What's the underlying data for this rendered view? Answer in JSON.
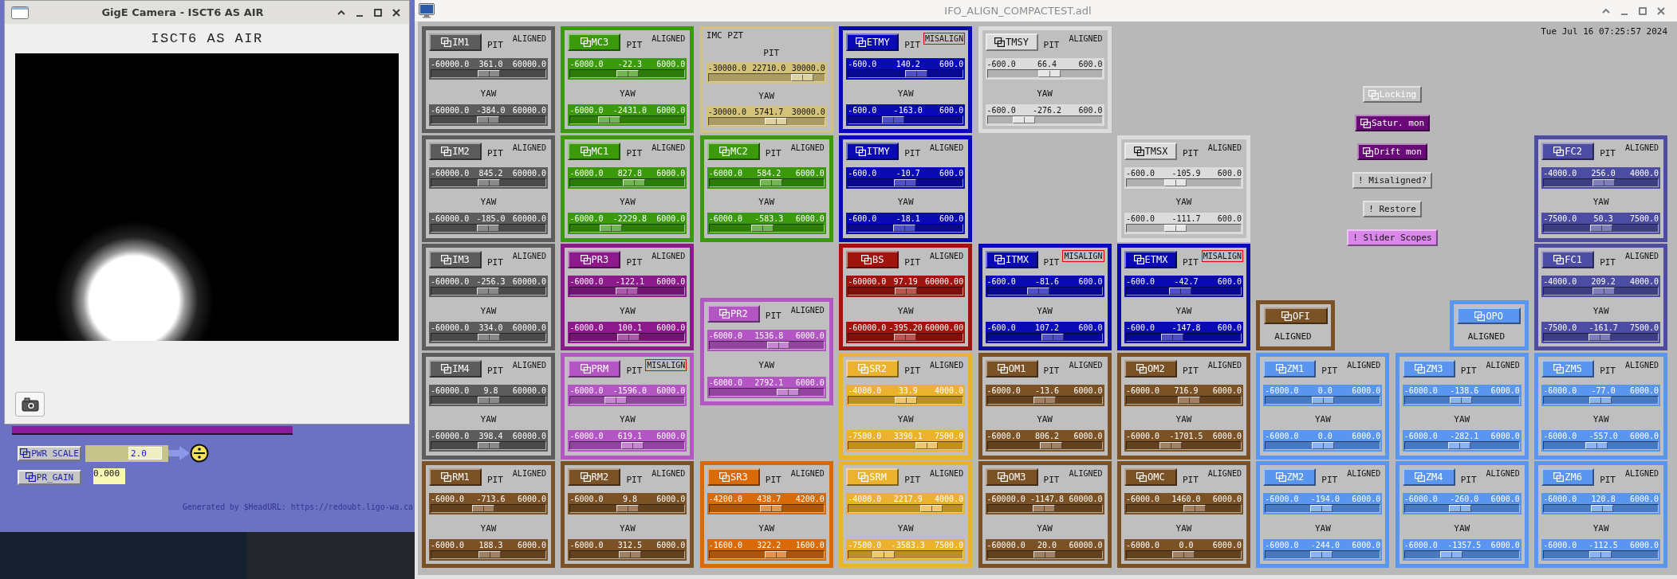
{
  "camera_window": {
    "title": "GigE Camera - ISCT6 AS AIR",
    "heading": "ISCT6 AS AIR"
  },
  "control_panel": {
    "controls": [
      {
        "kind": "entry",
        "label": "PWR SCALE",
        "value": "2.0"
      },
      {
        "kind": "readback",
        "label": "PR_GAIN",
        "value": "0.000"
      }
    ],
    "footer": "Generated by $HeadURL: https://redoubt.ligo-wa.ca"
  },
  "main_window": {
    "title": "IFO_ALIGN_COMPACTEST.adl",
    "timestamp": "Tue Jul 16 07:25:57 2024",
    "buttons": [
      {
        "kind": "related",
        "label": "Locking",
        "color": "#c4c4c4"
      },
      {
        "kind": "related",
        "label": "Satur. mon",
        "color": "#6a0a78"
      },
      {
        "kind": "related",
        "label": "Drift mon",
        "color": "#6a0a78"
      },
      {
        "kind": "shell",
        "label": "! Misaligned?",
        "color": "#c8c8c8"
      },
      {
        "kind": "shell",
        "label": "! Restore",
        "color": "#c8c8c8"
      },
      {
        "kind": "shell",
        "label": "! Slider Scopes",
        "color": "#d987e8"
      }
    ],
    "cards": [
      {
        "name": "IM1",
        "kind": "mirror",
        "color": "#5c5c5c",
        "status": "ALIGNED",
        "alarm": false,
        "sliders": [
          {
            "label": "PIT",
            "low": "-60000.0",
            "value": "361.0",
            "high": "60000.0",
            "level": 0.503
          },
          {
            "label": "YAW",
            "low": "-60000.0",
            "value": "-384.0",
            "high": "60000.0",
            "level": 0.497
          }
        ]
      },
      {
        "name": "MC3",
        "kind": "mirror",
        "color": "#3a9a0c",
        "status": "ALIGNED",
        "alarm": false,
        "sliders": [
          {
            "label": "PIT",
            "low": "-6000.0",
            "value": "-22.3",
            "high": "6000.0",
            "level": 0.498
          },
          {
            "label": "YAW",
            "low": "-6000.0",
            "value": "-2431.0",
            "high": "6000.0",
            "level": 0.297
          }
        ]
      },
      {
        "name": "IMC PZT",
        "kind": "pzt",
        "color": "#d3c27a",
        "sliders": [
          {
            "label": "PIT",
            "low": "-30000.0",
            "value": "22710.0",
            "high": "30000.0",
            "level": 0.879
          },
          {
            "label": "YAW",
            "low": "-30000.0",
            "value": "5741.7",
            "high": "30000.0",
            "level": 0.596
          }
        ]
      },
      {
        "name": "ETMY",
        "kind": "mirror",
        "color": "#0a0ab4",
        "status": "MISALIGN",
        "alarm": true,
        "sliders": [
          {
            "label": "PIT",
            "low": "-600.0",
            "value": "140.2",
            "high": "600.0",
            "level": 0.617
          },
          {
            "label": "YAW",
            "low": "-600.0",
            "value": "-163.0",
            "high": "600.0",
            "level": 0.364
          }
        ]
      },
      {
        "name": "TMSY",
        "kind": "mirror",
        "color": "#dcdcdc",
        "status": "ALIGNED",
        "alarm": false,
        "sliders": [
          {
            "label": "PIT",
            "low": "-600.0",
            "value": "66.4",
            "high": "600.0",
            "level": 0.555
          },
          {
            "label": "YAW",
            "low": "-600.0",
            "value": "-276.2",
            "high": "600.0",
            "level": 0.27
          }
        ]
      },
      {
        "name": "IM2",
        "kind": "mirror",
        "color": "#5c5c5c",
        "status": "ALIGNED",
        "alarm": false,
        "sliders": [
          {
            "label": "PIT",
            "low": "-60000.0",
            "value": "845.2",
            "high": "60000.0",
            "level": 0.507
          },
          {
            "label": "YAW",
            "low": "-60000.0",
            "value": "-185.0",
            "high": "60000.0",
            "level": 0.498
          }
        ]
      },
      {
        "name": "MC1",
        "kind": "mirror",
        "color": "#3a9a0c",
        "status": "ALIGNED",
        "alarm": false,
        "sliders": [
          {
            "label": "PIT",
            "low": "-6000.0",
            "value": "827.8",
            "high": "6000.0",
            "level": 0.569
          },
          {
            "label": "YAW",
            "low": "-6000.0",
            "value": "-2229.8",
            "high": "6000.0",
            "level": 0.314
          }
        ]
      },
      {
        "name": "MC2",
        "kind": "mirror",
        "color": "#3a9a0c",
        "status": "ALIGNED",
        "alarm": false,
        "sliders": [
          {
            "label": "PIT",
            "low": "-6000.0",
            "value": "584.2",
            "high": "6000.0",
            "level": 0.549
          },
          {
            "label": "YAW",
            "low": "-6000.0",
            "value": "-583.3",
            "high": "6000.0",
            "level": 0.451
          }
        ]
      },
      {
        "name": "ITMY",
        "kind": "mirror",
        "color": "#0a0ab4",
        "status": "ALIGNED",
        "alarm": false,
        "sliders": [
          {
            "label": "PIT",
            "low": "-600.0",
            "value": "-10.7",
            "high": "600.0",
            "level": 0.491
          },
          {
            "label": "YAW",
            "low": "-600.0",
            "value": "-18.1",
            "high": "600.0",
            "level": 0.485
          }
        ]
      },
      {
        "name": "TMSX",
        "kind": "mirror",
        "color": "#dcdcdc",
        "status": "ALIGNED",
        "alarm": false,
        "sliders": [
          {
            "label": "PIT",
            "low": "-600.0",
            "value": "-105.9",
            "high": "600.0",
            "level": 0.412
          },
          {
            "label": "YAW",
            "low": "-600.0",
            "value": "-111.7",
            "high": "600.0",
            "level": 0.407
          }
        ]
      },
      {
        "name": "FC2",
        "kind": "mirror",
        "color": "#4c4ca2",
        "status": "ALIGNED",
        "alarm": false,
        "sliders": [
          {
            "label": "PIT",
            "low": "-4000.0",
            "value": "256.0",
            "high": "4000.0",
            "level": 0.532
          },
          {
            "label": "YAW",
            "low": "-7500.0",
            "value": "50.3",
            "high": "7500.0",
            "level": 0.503
          }
        ]
      },
      {
        "name": "IM3",
        "kind": "mirror",
        "color": "#5c5c5c",
        "status": "ALIGNED",
        "alarm": false,
        "sliders": [
          {
            "label": "PIT",
            "low": "-60000.0",
            "value": "-256.3",
            "high": "60000.0",
            "level": 0.498
          },
          {
            "label": "YAW",
            "low": "-60000.0",
            "value": "334.0",
            "high": "60000.0",
            "level": 0.503
          }
        ]
      },
      {
        "name": "PR3",
        "kind": "mirror",
        "color": "#8c1a8c",
        "status": "ALIGNED",
        "alarm": false,
        "sliders": [
          {
            "label": "PIT",
            "low": "-6000.0",
            "value": "-122.1",
            "high": "6000.0",
            "level": 0.49
          },
          {
            "label": "YAW",
            "low": "-6000.0",
            "value": "100.1",
            "high": "6000.0",
            "level": 0.508
          }
        ]
      },
      {
        "name": "BS",
        "kind": "mirror",
        "color": "#a0140e",
        "status": "ALIGNED",
        "alarm": false,
        "sliders": [
          {
            "label": "PIT",
            "low": "-60000.0",
            "value": "97.19",
            "high": "60000.00",
            "level": 0.501
          },
          {
            "label": "YAW",
            "low": "-60000.0",
            "value": "-395.20",
            "high": "60000.00",
            "level": 0.497
          }
        ]
      },
      {
        "name": "ITMX",
        "kind": "mirror",
        "color": "#0a0ab4",
        "status": "MISALIGN",
        "alarm": true,
        "sliders": [
          {
            "label": "PIT",
            "low": "-600.0",
            "value": "-81.6",
            "high": "600.0",
            "level": 0.432
          },
          {
            "label": "YAW",
            "low": "-600.0",
            "value": "107.2",
            "high": "600.0",
            "level": 0.589
          }
        ]
      },
      {
        "name": "ETMX",
        "kind": "mirror",
        "color": "#0a0ab4",
        "status": "MISALIGN",
        "alarm": true,
        "sliders": [
          {
            "label": "PIT",
            "low": "-600.0",
            "value": "-42.7",
            "high": "600.0",
            "level": 0.464
          },
          {
            "label": "YAW",
            "low": "-600.0",
            "value": "-147.8",
            "high": "600.0",
            "level": 0.377
          }
        ]
      },
      {
        "name": "OFI",
        "kind": "compact",
        "color": "#7b5226",
        "status": "ALIGNED",
        "alarm": false
      },
      {
        "name": "OPO",
        "kind": "compact",
        "color": "#5a96f0",
        "status": "ALIGNED",
        "alarm": false
      },
      {
        "name": "FC1",
        "kind": "mirror",
        "color": "#4c4ca2",
        "status": "ALIGNED",
        "alarm": false,
        "sliders": [
          {
            "label": "PIT",
            "low": "-4000.0",
            "value": "209.2",
            "high": "4000.0",
            "level": 0.526
          },
          {
            "label": "YAW",
            "low": "-7500.0",
            "value": "-161.7",
            "high": "7500.0",
            "level": 0.489
          }
        ]
      },
      {
        "name": "PR2",
        "kind": "mirror",
        "color": "#b455c4",
        "status": "ALIGNED",
        "alarm": false,
        "sliders": [
          {
            "label": "PIT",
            "low": "-6000.0",
            "value": "1536.8",
            "high": "6000.0",
            "level": 0.628
          },
          {
            "label": "YAW",
            "low": "-6000.0",
            "value": "2792.1",
            "high": "6000.0",
            "level": 0.733
          }
        ]
      },
      {
        "name": "IM4",
        "kind": "mirror",
        "color": "#5c5c5c",
        "status": "ALIGNED",
        "alarm": false,
        "sliders": [
          {
            "label": "PIT",
            "low": "-60000.0",
            "value": "9.8",
            "high": "60000.0",
            "level": 0.5
          },
          {
            "label": "YAW",
            "low": "-60000.0",
            "value": "398.4",
            "high": "60000.0",
            "level": 0.503
          }
        ]
      },
      {
        "name": "PRM",
        "kind": "mirror",
        "color": "#b455c4",
        "status": "MISALIGN",
        "alarm": true,
        "sliders": [
          {
            "label": "PIT",
            "low": "-6000.0",
            "value": "-1596.0",
            "high": "6000.0",
            "level": 0.367
          },
          {
            "label": "YAW",
            "low": "-6000.0",
            "value": "619.1",
            "high": "6000.0",
            "level": 0.552
          }
        ]
      },
      {
        "name": "SR2",
        "kind": "mirror",
        "color": "#ebb22e",
        "status": "ALIGNED",
        "alarm": false,
        "sliders": [
          {
            "label": "PIT",
            "low": "-4000.0",
            "value": "33.9",
            "high": "4000.0",
            "level": 0.504
          },
          {
            "label": "YAW",
            "low": "-7500.0",
            "value": "3390.1",
            "high": "7500.0",
            "level": 0.726
          }
        ]
      },
      {
        "name": "OM1",
        "kind": "mirror",
        "color": "#7b5226",
        "status": "ALIGNED",
        "alarm": false,
        "sliders": [
          {
            "label": "PIT",
            "low": "-6000.0",
            "value": "-13.6",
            "high": "6000.0",
            "level": 0.499
          },
          {
            "label": "YAW",
            "low": "-6000.0",
            "value": "806.2",
            "high": "6000.0",
            "level": 0.567
          }
        ]
      },
      {
        "name": "OM2",
        "kind": "mirror",
        "color": "#7b5226",
        "status": "ALIGNED",
        "alarm": false,
        "sliders": [
          {
            "label": "PIT",
            "low": "-6000.0",
            "value": "716.9",
            "high": "6000.0",
            "level": 0.56
          },
          {
            "label": "YAW",
            "low": "-6000.0",
            "value": "-1701.5",
            "high": "6000.0",
            "level": 0.358
          }
        ]
      },
      {
        "name": "ZM1",
        "kind": "mirror",
        "color": "#5a96f0",
        "status": "ALIGNED",
        "alarm": false,
        "sliders": [
          {
            "label": "PIT",
            "low": "-6000.0",
            "value": "0.0",
            "high": "6000.0",
            "level": 0.5
          },
          {
            "label": "YAW",
            "low": "-6000.0",
            "value": "0.0",
            "high": "6000.0",
            "level": 0.5
          }
        ]
      },
      {
        "name": "ZM3",
        "kind": "mirror",
        "color": "#5a96f0",
        "status": "ALIGNED",
        "alarm": false,
        "sliders": [
          {
            "label": "PIT",
            "low": "-6000.0",
            "value": "-138.6",
            "high": "6000.0",
            "level": 0.488
          },
          {
            "label": "YAW",
            "low": "-6000.0",
            "value": "-282.1",
            "high": "6000.0",
            "level": 0.476
          }
        ]
      },
      {
        "name": "ZM5",
        "kind": "mirror",
        "color": "#5a96f0",
        "status": "ALIGNED",
        "alarm": false,
        "sliders": [
          {
            "label": "PIT",
            "low": "-6000.0",
            "value": "-77.0",
            "high": "6000.0",
            "level": 0.494
          },
          {
            "label": "YAW",
            "low": "-6000.0",
            "value": "-557.0",
            "high": "6000.0",
            "level": 0.454
          }
        ]
      },
      {
        "name": "RM1",
        "kind": "mirror",
        "color": "#7b5226",
        "status": "ALIGNED",
        "alarm": false,
        "sliders": [
          {
            "label": "PIT",
            "low": "-6000.0",
            "value": "-713.6",
            "high": "6000.0",
            "level": 0.441
          },
          {
            "label": "YAW",
            "low": "-6000.0",
            "value": "188.3",
            "high": "6000.0",
            "level": 0.516
          }
        ]
      },
      {
        "name": "RM2",
        "kind": "mirror",
        "color": "#7b5226",
        "status": "ALIGNED",
        "alarm": false,
        "sliders": [
          {
            "label": "PIT",
            "low": "-6000.0",
            "value": "9.8",
            "high": "6000.0",
            "level": 0.501
          },
          {
            "label": "YAW",
            "low": "-6000.0",
            "value": "312.5",
            "high": "6000.0",
            "level": 0.526
          }
        ]
      },
      {
        "name": "SR3",
        "kind": "mirror",
        "color": "#d86a08",
        "status": "ALIGNED",
        "alarm": false,
        "sliders": [
          {
            "label": "PIT",
            "low": "-4200.0",
            "value": "438.7",
            "high": "4200.0",
            "level": 0.552
          },
          {
            "label": "YAW",
            "low": "-1600.0",
            "value": "322.2",
            "high": "1600.0",
            "level": 0.601
          }
        ]
      },
      {
        "name": "SRM",
        "kind": "mirror",
        "color": "#ebb22e",
        "status": "ALIGNED",
        "alarm": false,
        "sliders": [
          {
            "label": "PIT",
            "low": "-4000.0",
            "value": "2217.9",
            "high": "4000.0",
            "level": 0.777
          },
          {
            "label": "YAW",
            "low": "-7500.0",
            "value": "-3583.3",
            "high": "7500.0",
            "level": 0.261
          }
        ]
      },
      {
        "name": "OM3",
        "kind": "mirror",
        "color": "#7b5226",
        "status": "ALIGNED",
        "alarm": false,
        "sliders": [
          {
            "label": "PIT",
            "low": "-60000.0",
            "value": "-1147.8",
            "high": "60000.0",
            "level": 0.49
          },
          {
            "label": "YAW",
            "low": "-60000.0",
            "value": "20.0",
            "high": "60000.0",
            "level": 0.5
          }
        ]
      },
      {
        "name": "OMC",
        "kind": "mirror",
        "color": "#7b5226",
        "status": "ALIGNED",
        "alarm": false,
        "sliders": [
          {
            "label": "PIT",
            "low": "-6000.0",
            "value": "1460.0",
            "high": "6000.0",
            "level": 0.622
          },
          {
            "label": "YAW",
            "low": "-6000.0",
            "value": "0.0",
            "high": "6000.0",
            "level": 0.5
          }
        ]
      },
      {
        "name": "ZM2",
        "kind": "mirror",
        "color": "#5a96f0",
        "status": "ALIGNED",
        "alarm": false,
        "sliders": [
          {
            "label": "PIT",
            "low": "-6000.0",
            "value": "-194.0",
            "high": "6000.0",
            "level": 0.484
          },
          {
            "label": "YAW",
            "low": "-6000.0",
            "value": "-244.0",
            "high": "6000.0",
            "level": 0.48
          }
        ]
      },
      {
        "name": "ZM4",
        "kind": "mirror",
        "color": "#5a96f0",
        "status": "ALIGNED",
        "alarm": false,
        "sliders": [
          {
            "label": "PIT",
            "low": "-6000.0",
            "value": "-260.0",
            "high": "6000.0",
            "level": 0.478
          },
          {
            "label": "YAW",
            "low": "-6000.0",
            "value": "-1357.5",
            "high": "6000.0",
            "level": 0.387
          }
        ]
      },
      {
        "name": "ZM6",
        "kind": "mirror",
        "color": "#5a96f0",
        "status": "ALIGNED",
        "alarm": false,
        "sliders": [
          {
            "label": "PIT",
            "low": "-6000.0",
            "value": "120.8",
            "high": "6000.0",
            "level": 0.51
          },
          {
            "label": "YAW",
            "low": "-6000.0",
            "value": "-112.5",
            "high": "6000.0",
            "level": 0.491
          }
        ]
      }
    ]
  }
}
